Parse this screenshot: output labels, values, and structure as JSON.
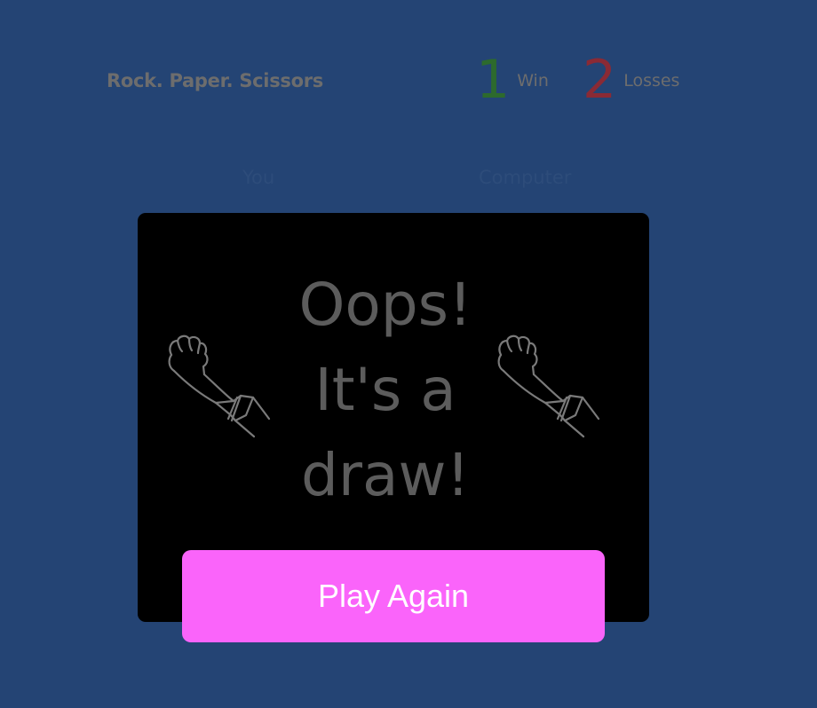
{
  "header": {
    "title": "Rock. Paper. Scissors"
  },
  "scoreboard": {
    "wins": {
      "count": "1",
      "label": "Win",
      "color": "#2d6a2d"
    },
    "losses": {
      "count": "2",
      "label": "Losses",
      "color": "#8a2a35"
    }
  },
  "players": {
    "you_label": "You",
    "computer_label": "Computer"
  },
  "board": {
    "you_choice_icon": "rock-hand-icon",
    "computer_choice_icon": "rock-hand-icon",
    "result_lines": [
      "Oops!",
      "It's a",
      "draw!"
    ]
  },
  "actions": {
    "play_again_label": "Play Again",
    "play_again_color": "#fa64fa"
  },
  "colors": {
    "background": "#244474",
    "board": "#000000",
    "muted_text": "#6d6d6d"
  }
}
